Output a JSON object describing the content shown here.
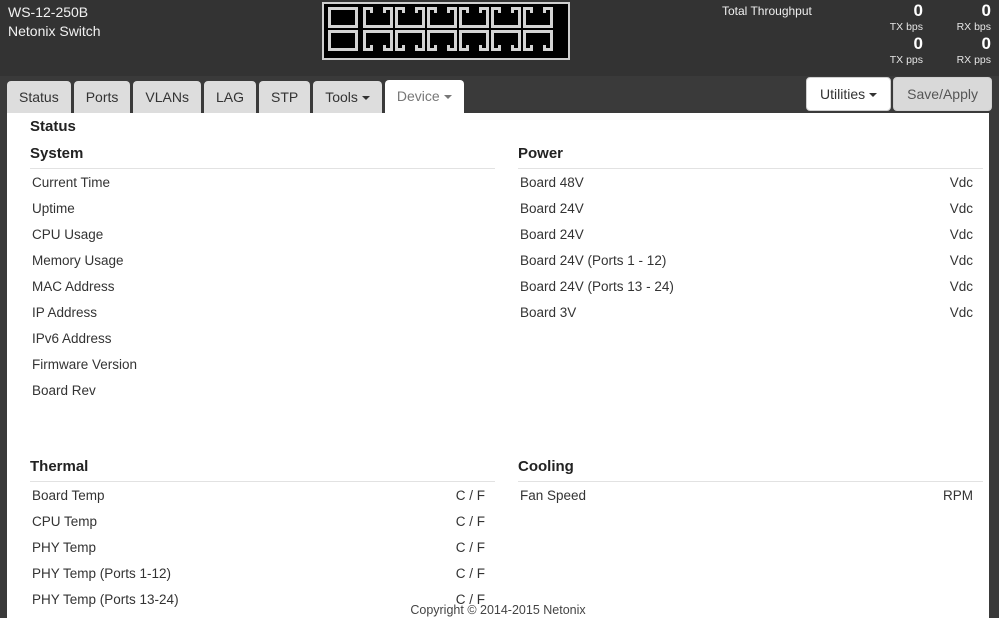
{
  "header": {
    "model": "WS-12-250B",
    "subtitle": "Netonix Switch",
    "throughput_label": "Total Throughput",
    "throughput": [
      {
        "value": "0",
        "unit": "TX bps"
      },
      {
        "value": "0",
        "unit": "RX bps"
      },
      {
        "value": "0",
        "unit": "TX pps"
      },
      {
        "value": "0",
        "unit": "RX pps"
      }
    ],
    "port_graphic": {
      "sfp_count": 2,
      "rj45_count": 12,
      "rows": 2
    }
  },
  "tabs": [
    {
      "label": "Status",
      "active": false,
      "caret": false
    },
    {
      "label": "Ports",
      "active": false,
      "caret": false
    },
    {
      "label": "VLANs",
      "active": false,
      "caret": false
    },
    {
      "label": "LAG",
      "active": false,
      "caret": false
    },
    {
      "label": "STP",
      "active": false,
      "caret": false
    },
    {
      "label": "Tools",
      "active": false,
      "caret": true
    },
    {
      "label": "Device",
      "active": true,
      "caret": true
    }
  ],
  "toolbar": {
    "utilities_label": "Utilities",
    "save_apply_label": "Save/Apply"
  },
  "page": {
    "title": "Status",
    "sections": {
      "system": {
        "title": "System",
        "rows": [
          {
            "label": "Current Time",
            "unit": ""
          },
          {
            "label": "Uptime",
            "unit": ""
          },
          {
            "label": "CPU Usage",
            "unit": ""
          },
          {
            "label": "Memory Usage",
            "unit": ""
          },
          {
            "label": "MAC Address",
            "unit": ""
          },
          {
            "label": "IP Address",
            "unit": ""
          },
          {
            "label": "IPv6 Address",
            "unit": ""
          },
          {
            "label": "Firmware Version",
            "unit": ""
          },
          {
            "label": "Board Rev",
            "unit": ""
          }
        ]
      },
      "power": {
        "title": "Power",
        "rows": [
          {
            "label": "Board 48V",
            "unit": "Vdc"
          },
          {
            "label": "Board 24V",
            "unit": "Vdc"
          },
          {
            "label": "Board 24V",
            "unit": "Vdc"
          },
          {
            "label": "Board 24V (Ports 1 - 12)",
            "unit": "Vdc"
          },
          {
            "label": "Board 24V (Ports 13 - 24)",
            "unit": "Vdc"
          },
          {
            "label": "Board 3V",
            "unit": "Vdc"
          }
        ]
      },
      "thermal": {
        "title": "Thermal",
        "rows": [
          {
            "label": "Board Temp",
            "unit": "C / F"
          },
          {
            "label": "CPU Temp",
            "unit": "C / F"
          },
          {
            "label": "PHY Temp",
            "unit": "C / F"
          },
          {
            "label": "PHY Temp (Ports 1-12)",
            "unit": "C / F"
          },
          {
            "label": "PHY Temp (Ports 13-24)",
            "unit": "C / F"
          }
        ]
      },
      "cooling": {
        "title": "Cooling",
        "rows": [
          {
            "label": "Fan Speed",
            "unit": "RPM"
          }
        ]
      }
    },
    "footer": "Copyright © 2014-2015 Netonix"
  },
  "colors": {
    "header_bg": "#333333",
    "tab_bg": "#dddddd",
    "tab_active_bg": "#ffffff",
    "content_bg": "#ffffff",
    "page_bg": "#3a3a3a"
  }
}
